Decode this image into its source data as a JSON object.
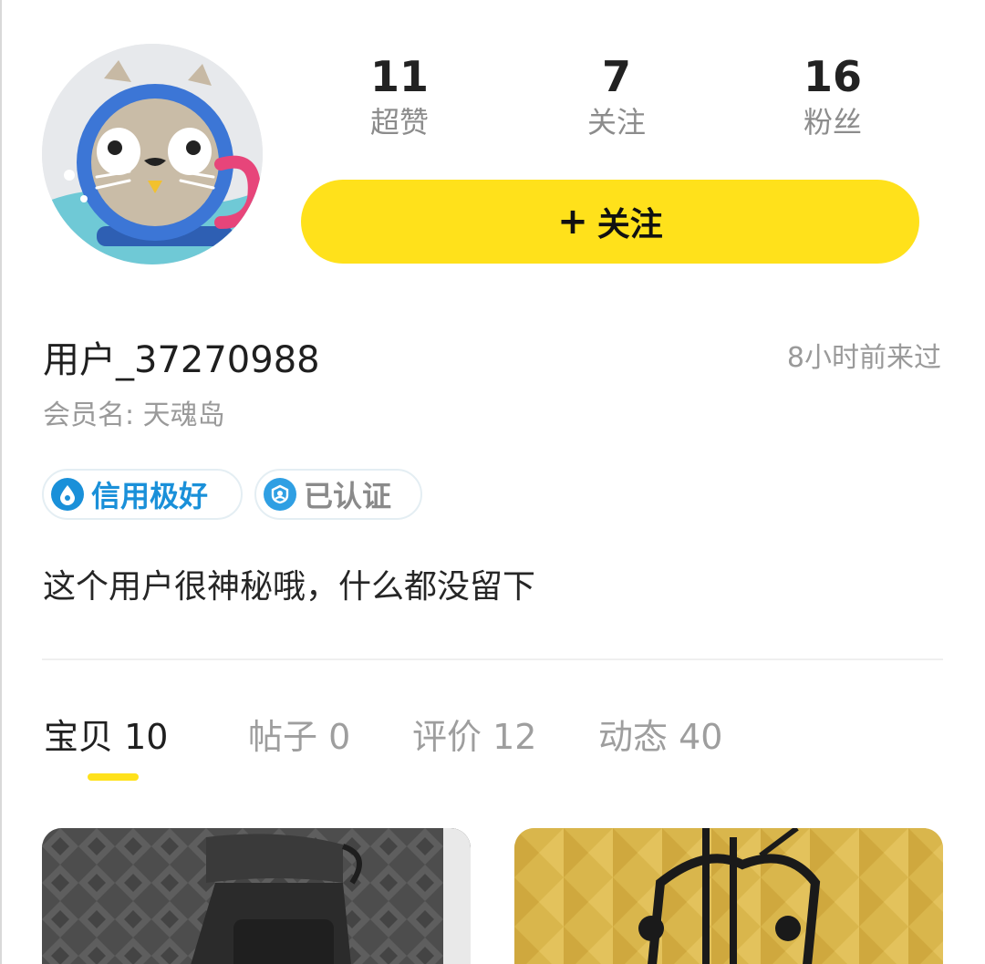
{
  "stats": [
    {
      "value": "11",
      "label": "超赞"
    },
    {
      "value": "7",
      "label": "关注"
    },
    {
      "value": "16",
      "label": "粉丝"
    }
  ],
  "follow_button": {
    "icon": "+",
    "label": "关注"
  },
  "user": {
    "username": "用户_37270988",
    "last_seen": "8小时前来过",
    "member_name": "会员名: 天魂岛",
    "bio": "这个用户很神秘哦，什么都没留下"
  },
  "badges": [
    {
      "label": "信用极好",
      "icon": "water-drop-icon",
      "color": "#1a90d9"
    },
    {
      "label": "已认证",
      "icon": "verified-user-icon",
      "color": "#2f9fe3"
    }
  ],
  "tabs": [
    {
      "label": "宝贝 10",
      "active": true
    },
    {
      "label": "帖子 0",
      "active": false
    },
    {
      "label": "评价 12",
      "active": false
    },
    {
      "label": "动态 40",
      "active": false
    }
  ],
  "products": [
    {
      "icon": "vr-headset-photo"
    },
    {
      "icon": "vr-controller-stand-photo"
    }
  ],
  "colors": {
    "accent": "#ffe11b",
    "credit_blue": "#1a90d9",
    "muted_text": "#9a9a9a"
  }
}
